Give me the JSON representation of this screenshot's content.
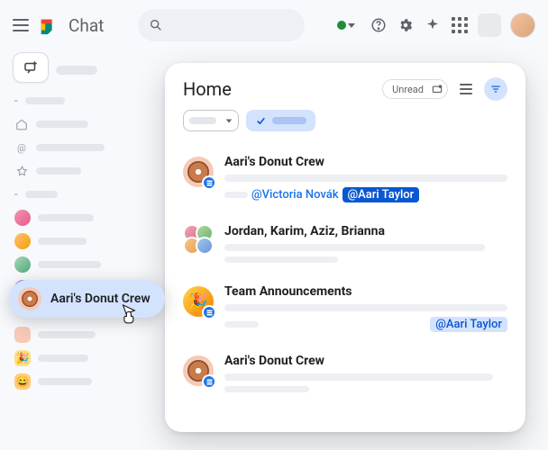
{
  "app": {
    "title": "Chat"
  },
  "panel": {
    "title": "Home",
    "unread_label": "Unread"
  },
  "convos": [
    {
      "title": "Aari's Donut Crew",
      "mention1_text": "@Victoria Novák",
      "mention2_text": "@Aari Taylor"
    },
    {
      "title": "Jordan, Karim, Aziz, Brianna"
    },
    {
      "title": "Team Announcements",
      "mention_text": "@Aari Taylor"
    },
    {
      "title": "Aari's Donut Crew"
    }
  ],
  "popup": {
    "title": "Aari's Donut Crew"
  }
}
